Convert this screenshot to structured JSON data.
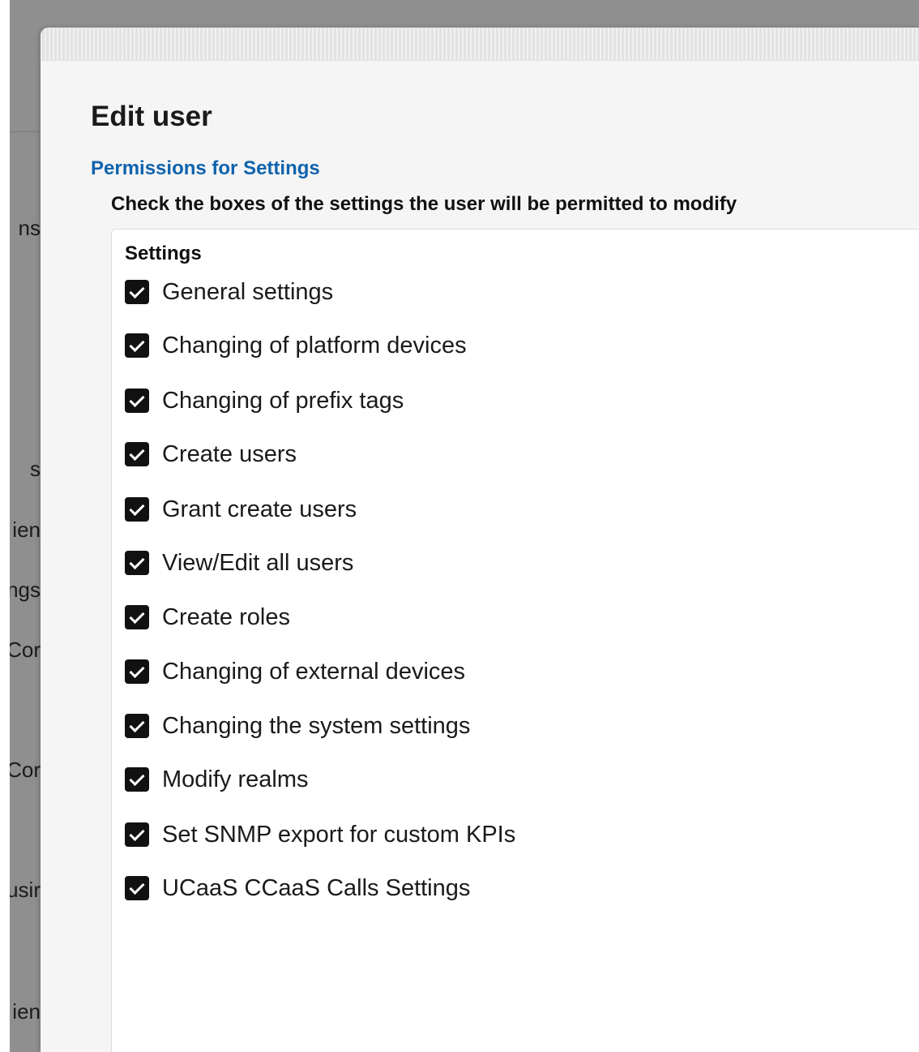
{
  "background": {
    "sidebar_fragments": [
      "ns",
      "s",
      "ien",
      "ngs",
      "Cor",
      "Cor",
      "usir",
      "ien"
    ]
  },
  "modal": {
    "title": "Edit user",
    "section_link": "Permissions for Settings",
    "instructions": "Check the boxes of the settings the user will be permitted to modify",
    "panel": {
      "heading": "Settings",
      "items": [
        {
          "label": "General settings",
          "checked": true
        },
        {
          "label": "Changing of platform devices",
          "checked": true
        },
        {
          "label": "Changing of prefix tags",
          "checked": true
        },
        {
          "label": "Create users",
          "checked": true
        },
        {
          "label": "Grant create users",
          "checked": true
        },
        {
          "label": "View/Edit all users",
          "checked": true
        },
        {
          "label": "Create roles",
          "checked": true
        },
        {
          "label": "Changing of external devices",
          "checked": true
        },
        {
          "label": "Changing the system settings",
          "checked": true
        },
        {
          "label": "Modify realms",
          "checked": true
        },
        {
          "label": "Set SNMP export for custom KPIs",
          "checked": true
        },
        {
          "label": "UCaaS CCaaS Calls Settings",
          "checked": true
        }
      ]
    }
  },
  "colors": {
    "link": "#0f63ad",
    "checkbox": "#111111",
    "backdrop": "#8f8f8f"
  }
}
